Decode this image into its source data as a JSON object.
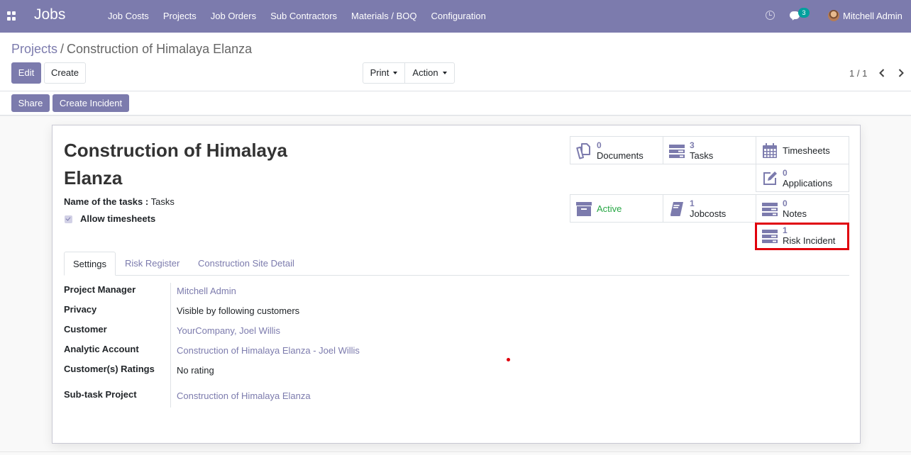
{
  "navbar": {
    "brand": "Jobs",
    "menu": [
      "Job Costs",
      "Projects",
      "Job Orders",
      "Sub Contractors",
      "Materials / BOQ",
      "Configuration"
    ],
    "chat_count": "3",
    "user_name": "Mitchell Admin"
  },
  "breadcrumb": {
    "parent": "Projects",
    "separator": "/",
    "current": "Construction of Himalaya Elanza"
  },
  "toolbar": {
    "edit_label": "Edit",
    "create_label": "Create",
    "print_label": "Print",
    "action_label": "Action",
    "pager": "1 / 1"
  },
  "statusbar": {
    "share_label": "Share",
    "create_incident_label": "Create Incident"
  },
  "form": {
    "title_line1": "Construction of Himalaya",
    "title_line2": "Elanza",
    "task_name_label": "Name of the tasks :",
    "task_name_value": "Tasks",
    "allow_timesheets_label": "Allow timesheets",
    "allow_timesheets_checked": true
  },
  "smart_buttons": {
    "documents": {
      "count": "0",
      "label": "Documents",
      "icon": "files-icon"
    },
    "tasks": {
      "count": "3",
      "label": "Tasks",
      "icon": "tasks-icon"
    },
    "timesheets": {
      "label": "Timesheets",
      "icon": "calendar-icon"
    },
    "applications": {
      "count": "0",
      "label": "Applications",
      "icon": "pencil-square-icon"
    },
    "active": {
      "label": "Active",
      "icon": "archive-icon"
    },
    "jobcosts": {
      "count": "1",
      "label": "Jobcosts",
      "icon": "book-icon"
    },
    "notes": {
      "count": "0",
      "label": "Notes",
      "icon": "tasks-icon"
    },
    "risk_incident": {
      "count": "1",
      "label": "Risk Incident",
      "icon": "tasks-icon"
    }
  },
  "tabs": [
    "Settings",
    "Risk Register",
    "Construction Site Detail"
  ],
  "settings": {
    "project_manager_label": "Project Manager",
    "project_manager_value": "Mitchell Admin",
    "privacy_label": "Privacy",
    "privacy_value": "Visible by following customers",
    "customer_label": "Customer",
    "customer_value": "YourCompany, Joel Willis",
    "analytic_label": "Analytic Account",
    "analytic_value": "Construction of Himalaya Elanza - Joel Willis",
    "ratings_label": "Customer(s) Ratings",
    "ratings_value": "No rating",
    "subtask_label": "Sub-task Project",
    "subtask_value": "Construction of Himalaya Elanza"
  },
  "colors": {
    "brand": "#7c7bad",
    "active_green": "#28a745",
    "highlight_red": "#e0000c"
  }
}
